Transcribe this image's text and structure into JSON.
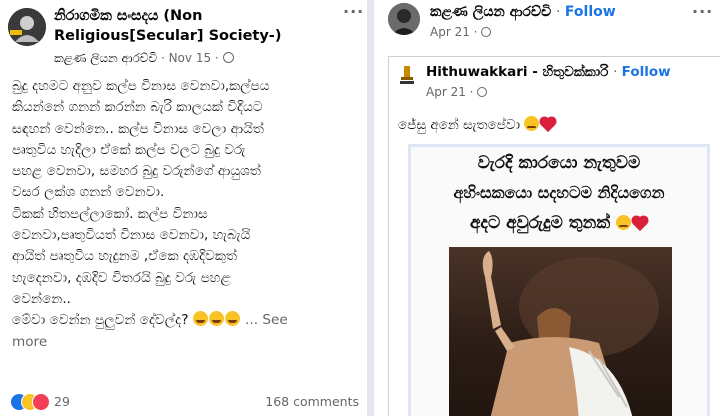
{
  "left_post": {
    "page_name_line1": "නිරාගමික සංසදය (Non",
    "page_name_line2": "Religious[Secular] Society-)",
    "author": "කළණ ලියන ආරච්චි",
    "date": "Nov 15",
    "lines": [
      "බුදු දහමට අනුව කල්ප විනාස වෙනවා,කල්පය",
      "කියන්නේ ගනන් කරන්න බැරි කාලයක් විදියට",
      "සඳහන් වෙන්නෙ.. කල්ප විනාස වෙලා ආයිත්",
      "පෘතුවිය හැදිලා ඒකේ කල්ප වලට බුදු වරු",
      "පහළ වෙනවා, සමහර බුදු වරුන්ගේ ආයුශත්",
      "වසර ලක්ශ ගනන් වෙනවා.",
      "ටිකක් හිතපල්ලාකෝ. කල්ප විනාස",
      "වෙනවා,පෘතුවියත් විනාස වෙනවා, හැබැයි",
      "ආයිත් පෘතුවිය හැදුනම ,ඒකෙ දඹදිවකුත්",
      "හැදෙනවා, දඹදිව විතරයි බුදු වරු පහළ",
      "වෙන්නෙ..",
      "මේවා වෙන්න පුලුවන් දේවල්ද?"
    ],
    "see_more_inline": "... See",
    "see_more_wrap": "more",
    "reaction_count": "29",
    "comments": "168 comments"
  },
  "right_post": {
    "author": "කළණ ලියන ආරච්චි",
    "follow": "Follow",
    "date": "Apr 21",
    "shared_page": "Hithuwakkari - හිතුවක්කාරි",
    "shared_date": "Apr 21",
    "caption": "ජේසු අනේ සැතපේවා",
    "poster_lines": [
      "වැරදි කාරයො නැතුවම",
      "අහිංසකයො සදහටම නිදියගෙන",
      "අදට අවුරුදුම තුනක්"
    ]
  },
  "colors": {
    "link_blue": "#1b74e4",
    "meta_gray": "#65676b",
    "divider": "#e4e6eb"
  },
  "icons": [
    "avatar",
    "globe-icon",
    "more-dots-icon",
    "laughing-emoji",
    "sad-emoji",
    "broken-heart-icon",
    "like-reaction",
    "haha-reaction",
    "love-reaction"
  ]
}
